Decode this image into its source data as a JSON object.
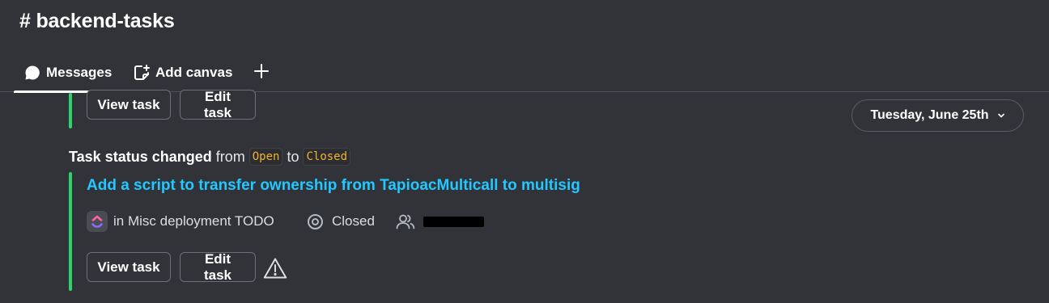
{
  "channel": {
    "title": "# backend-tasks"
  },
  "tabs": {
    "messages_label": "Messages",
    "canvas_label": "Add canvas",
    "add_label": "+"
  },
  "previous_task": {
    "view_label": "View task",
    "edit_label": "Edit task"
  },
  "date_divider": {
    "label": "Tuesday, June 25th"
  },
  "status_change": {
    "prefix": "Task status changed",
    "from_word": "from",
    "from_value": "Open",
    "to_word": "to",
    "to_value": "Closed"
  },
  "task": {
    "title": "Add a script to transfer ownership from TapioacMulticall to multisig",
    "list_label": "in Misc deployment TODO",
    "status_label": "Closed",
    "view_label": "View task",
    "edit_label": "Edit task"
  },
  "icons": {
    "messages": "chat-bubble-icon",
    "canvas": "canvas-icon",
    "add": "plus-icon",
    "app": "clickup-logo-icon",
    "status": "status-circle-icon",
    "assignee": "people-icon",
    "warning": "warning-triangle-icon",
    "chevron": "chevron-down-icon"
  },
  "colors": {
    "background": "#313338",
    "accent_bar": "#2bd56b",
    "link": "#22c8ff",
    "code_text": "#f0b232"
  }
}
